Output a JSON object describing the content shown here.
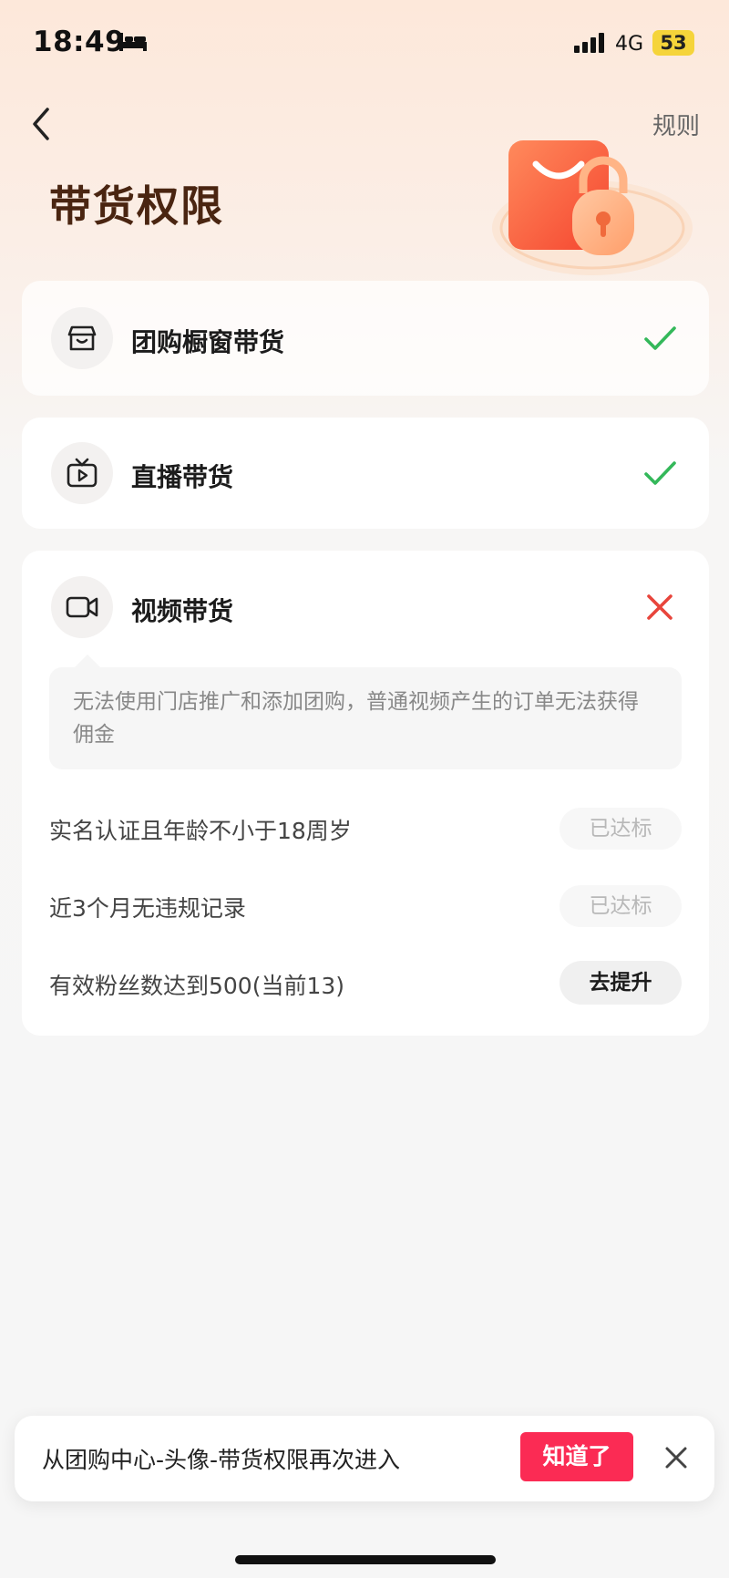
{
  "status_bar": {
    "time": "18:49",
    "network": "4G",
    "battery": "53"
  },
  "header": {
    "back_icon": "chevron-left-icon",
    "rules_label": "规则",
    "title": "带货权限"
  },
  "permissions": [
    {
      "label": "团购橱窗带货",
      "icon": "storefront-icon",
      "status": "granted"
    },
    {
      "label": "直播带货",
      "icon": "tv-play-icon",
      "status": "granted"
    },
    {
      "label": "视频带货",
      "icon": "video-camera-icon",
      "status": "denied"
    }
  ],
  "video_card": {
    "notice": "无法使用门店推广和添加团购，普通视频产生的订单无法获得佣金",
    "requirements": [
      {
        "label": "实名认证且年龄不小于18周岁",
        "action": "已达标"
      },
      {
        "label": "近3个月无违规记录",
        "action": "已达标"
      },
      {
        "label": "有效粉丝数达到500(当前13)",
        "action": "去提升"
      }
    ]
  },
  "toast": {
    "text": "从团购中心-头像-带货权限再次进入",
    "confirm_label": "知道了"
  },
  "colors": {
    "granted": "#34b85a",
    "denied": "#e8453c",
    "accent": "#fb2b54",
    "title": "#4a2511"
  }
}
